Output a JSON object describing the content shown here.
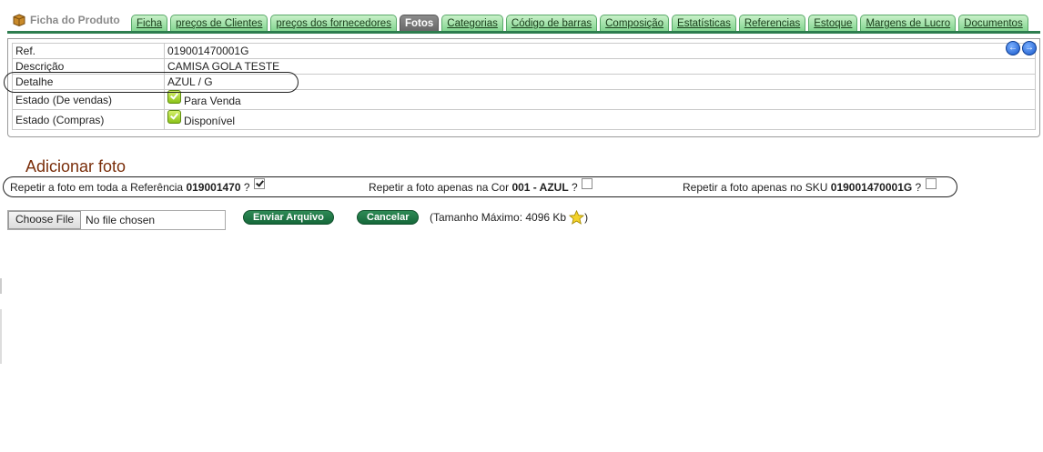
{
  "product_tab": {
    "title": "Ficha do Produto",
    "icon": "box-icon"
  },
  "tabs": [
    {
      "label": "Ficha",
      "active": false
    },
    {
      "label": "preços de Clientes",
      "active": false
    },
    {
      "label": "preços dos fornecedores",
      "active": false
    },
    {
      "label": "Fotos",
      "active": true
    },
    {
      "label": "Categorias",
      "active": false
    },
    {
      "label": "Código de barras",
      "active": false
    },
    {
      "label": "Composição",
      "active": false
    },
    {
      "label": "Estatísticas",
      "active": false
    },
    {
      "label": "Referencias",
      "active": false
    },
    {
      "label": "Estoque",
      "active": false
    },
    {
      "label": "Margens de Lucro",
      "active": false
    },
    {
      "label": "Documentos",
      "active": false
    }
  ],
  "info": {
    "ref_label": "Ref.",
    "ref_value": "019001470001G",
    "desc_label": "Descrição",
    "desc_value": "CAMISA GOLA TESTE",
    "detail_label": "Detalhe",
    "detail_value": "AZUL / G",
    "sales_label": "Estado (De vendas)",
    "sales_value": "Para Venda",
    "purchase_label": "Estado (Compras)",
    "purchase_value": "Disponível"
  },
  "nav": {
    "prev_icon": "arrow-left-icon",
    "next_icon": "arrow-right-icon"
  },
  "add_photo": {
    "heading": "Adicionar foto",
    "opt1_prefix": "Repetir a foto em toda a Referência ",
    "opt1_bold": "019001470",
    "opt1_suffix": " ?",
    "opt1_checked": true,
    "opt2_prefix": "Repetir a foto apenas na Cor ",
    "opt2_bold": "001 - AZUL",
    "opt2_suffix": " ?",
    "opt2_checked": false,
    "opt3_prefix": "Repetir a foto apenas no SKU ",
    "opt3_bold": "019001470001G",
    "opt3_suffix": " ?",
    "opt3_checked": false
  },
  "upload": {
    "choose_label": "Choose File",
    "no_file": "No file chosen",
    "send_label": "Enviar Arquivo",
    "cancel_label": "Cancelar",
    "max_open": "(Tamanho Máximo: 4096 Kb",
    "max_close": ")"
  },
  "colors": {
    "tab_green": "#7fd48d",
    "accent_line": "#2e7d4f",
    "heading": "#7a2e0a",
    "button_green": "#15683a"
  }
}
